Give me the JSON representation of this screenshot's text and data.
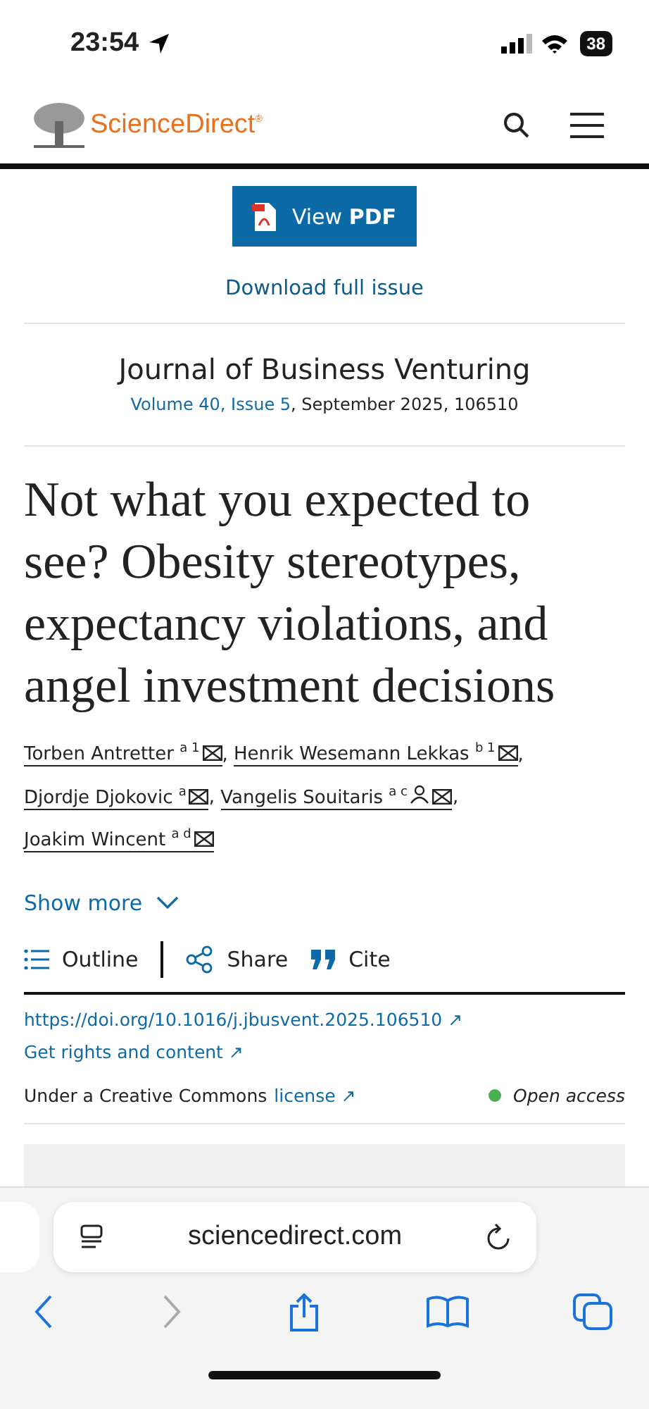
{
  "status_bar": {
    "time": "23:54",
    "battery": "38"
  },
  "header": {
    "logo": "ScienceDirect",
    "registered": "®"
  },
  "pdf_button": {
    "label": "View",
    "bold": "PDF"
  },
  "download_link": "Download full issue",
  "journal": {
    "title": "Journal of Business Venturing",
    "volume": "Volume 40, Issue 5",
    "details": ", September 2025, 106510"
  },
  "article_title": "Not what you expected to see? Obesity stereotypes, expectancy violations, and angel investment decisions",
  "authors": [
    {
      "name": "Torben Antretter",
      "marks": "a 1",
      "corresponding": false,
      "separator": ","
    },
    {
      "name": "Henrik Wesemann Lekkas",
      "marks": "b 1",
      "corresponding": false,
      "separator": ","
    },
    {
      "name": "Djordje Djokovic",
      "marks": "a",
      "corresponding": false,
      "separator": ","
    },
    {
      "name": "Vangelis Souitaris",
      "marks": "a c",
      "corresponding": true,
      "separator": ","
    },
    {
      "name": "Joakim Wincent",
      "marks": "a d",
      "corresponding": false
    }
  ],
  "show_more": "Show more",
  "toolbar": [
    {
      "kind": "outline",
      "label": "Outline"
    },
    {
      "kind": "share",
      "label": "Share"
    },
    {
      "kind": "cite",
      "label": "Cite"
    }
  ],
  "doi": "https://doi.org/10.1016/j.jbusvent.2025.106510 ↗",
  "rights": "Get rights and content ↗",
  "license": {
    "text": "Under a Creative Commons",
    "link": "license ↗"
  },
  "access": {
    "label": "Open access",
    "color": "#4caf50"
  },
  "browser": {
    "url": "sciencedirect.com",
    "nav": [
      {
        "kind": "back",
        "disabled": false
      },
      {
        "kind": "forward",
        "disabled": true
      },
      {
        "kind": "share"
      },
      {
        "kind": "bookmarks"
      },
      {
        "kind": "tabs"
      }
    ]
  }
}
